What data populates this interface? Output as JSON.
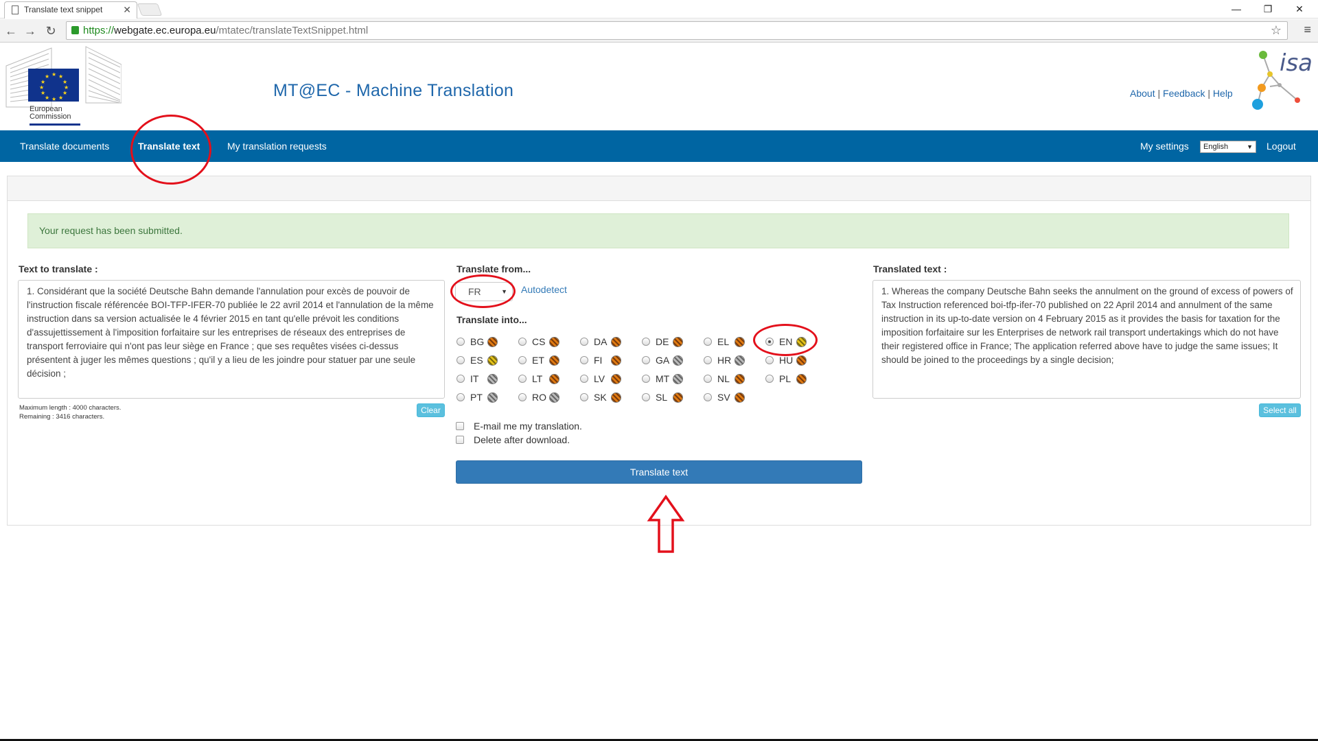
{
  "browser": {
    "tab_title": "Translate text snippet",
    "url_scheme": "https://",
    "url_domain": "webgate.ec.europa.eu",
    "url_path": "/mtatec/translateTextSnippet.html"
  },
  "header": {
    "org_line1": "European",
    "org_line2": "Commission",
    "site_title": "MT@EC - Machine Translation",
    "links": {
      "about": "About",
      "feedback": "Feedback",
      "help": "Help",
      "sep": "|"
    },
    "isa_text": "isa"
  },
  "nav": {
    "items": [
      "Translate documents",
      "Translate text",
      "My translation requests"
    ],
    "my_settings": "My settings",
    "ui_language": "English",
    "logout": "Logout"
  },
  "alert": {
    "message": "Your request has been submitted."
  },
  "source": {
    "label": "Text to translate :",
    "text": "1. Considérant que la société Deutsche Bahn demande l'annulation pour excès de pouvoir de l'instruction fiscale référencée BOI-TFP-IFER-70 publiée le 22 avril 2014 et l'annulation de la même instruction dans sa version actualisée le 4 février 2015 en tant qu'elle prévoit les conditions d'assujettissement à l'imposition forfaitaire sur les entreprises de réseaux des entreprises de transport ferroviaire qui n'ont pas leur siège en France ; que ses requêtes visées ci-dessus présentent à juger les mêmes questions ; qu'il y a lieu de les joindre pour statuer par une seule décision ;",
    "max_length": "Maximum length : 4000 characters.",
    "remaining": "Remaining : 3416 characters.",
    "clear_label": "Clear"
  },
  "options": {
    "translate_from_label": "Translate from...",
    "from_value": "FR",
    "autodetect_label": "Autodetect",
    "translate_into_label": "Translate into...",
    "languages": [
      {
        "code": "BG",
        "shield": "orange",
        "selected": false
      },
      {
        "code": "CS",
        "shield": "orange",
        "selected": false
      },
      {
        "code": "DA",
        "shield": "orange",
        "selected": false
      },
      {
        "code": "DE",
        "shield": "orange",
        "selected": false
      },
      {
        "code": "EL",
        "shield": "orange",
        "selected": false
      },
      {
        "code": "EN",
        "shield": "yellow",
        "selected": true
      },
      {
        "code": "ES",
        "shield": "yellow",
        "selected": false
      },
      {
        "code": "ET",
        "shield": "orange",
        "selected": false
      },
      {
        "code": "FI",
        "shield": "orange",
        "selected": false
      },
      {
        "code": "GA",
        "shield": "gray",
        "selected": false
      },
      {
        "code": "HR",
        "shield": "gray",
        "selected": false
      },
      {
        "code": "HU",
        "shield": "orange",
        "selected": false
      },
      {
        "code": "IT",
        "shield": "gray",
        "selected": false
      },
      {
        "code": "LT",
        "shield": "orange",
        "selected": false
      },
      {
        "code": "LV",
        "shield": "orange",
        "selected": false
      },
      {
        "code": "MT",
        "shield": "gray",
        "selected": false
      },
      {
        "code": "NL",
        "shield": "orange",
        "selected": false
      },
      {
        "code": "PL",
        "shield": "orange",
        "selected": false
      },
      {
        "code": "PT",
        "shield": "gray",
        "selected": false
      },
      {
        "code": "RO",
        "shield": "gray",
        "selected": false
      },
      {
        "code": "SK",
        "shield": "orange",
        "selected": false
      },
      {
        "code": "SL",
        "shield": "orange",
        "selected": false
      },
      {
        "code": "SV",
        "shield": "orange",
        "selected": false
      }
    ],
    "email_label": "E-mail me my translation.",
    "delete_label": "Delete after download.",
    "submit_label": "Translate text"
  },
  "target": {
    "label": "Translated text :",
    "text": "1.  Whereas the company Deutsche Bahn seeks the annulment on the ground of excess of powers of Tax Instruction referenced boi-tfp-ifer-70 published on 22 April 2014 and annulment of the same instruction in its up-to-date version on 4 February 2015 as it provides the basis for taxation for the imposition forfaitaire sur les Enterprises de network rail transport undertakings which do not have their registered office in France;  The application referred above have to judge the same issues;  It should be joined to the proceedings by a single decision;",
    "select_all_label": "Select all"
  },
  "colors": {
    "brand_blue": "#0065a2",
    "annotation_red": "#e3101b",
    "success_bg": "#dff0d8"
  }
}
